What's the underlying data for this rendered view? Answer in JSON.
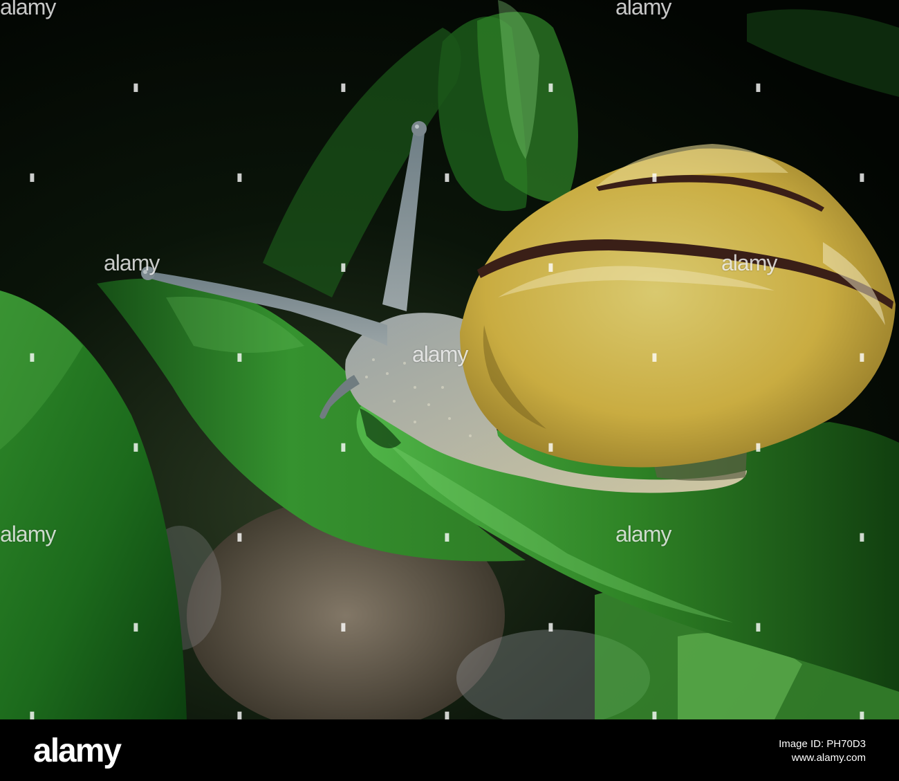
{
  "photo": {
    "subject": "snail-on-leaf",
    "colors": {
      "leaf": "#2f8a2a",
      "shell": "#d4c15f",
      "shell_band": "#3a1f17",
      "body": "#8d9a9d",
      "background": "#061006"
    }
  },
  "watermark": {
    "text": "alamy"
  },
  "footer": {
    "logo": "alamy",
    "image_id": "Image ID: PH70D3",
    "url": "www.alamy.com"
  }
}
